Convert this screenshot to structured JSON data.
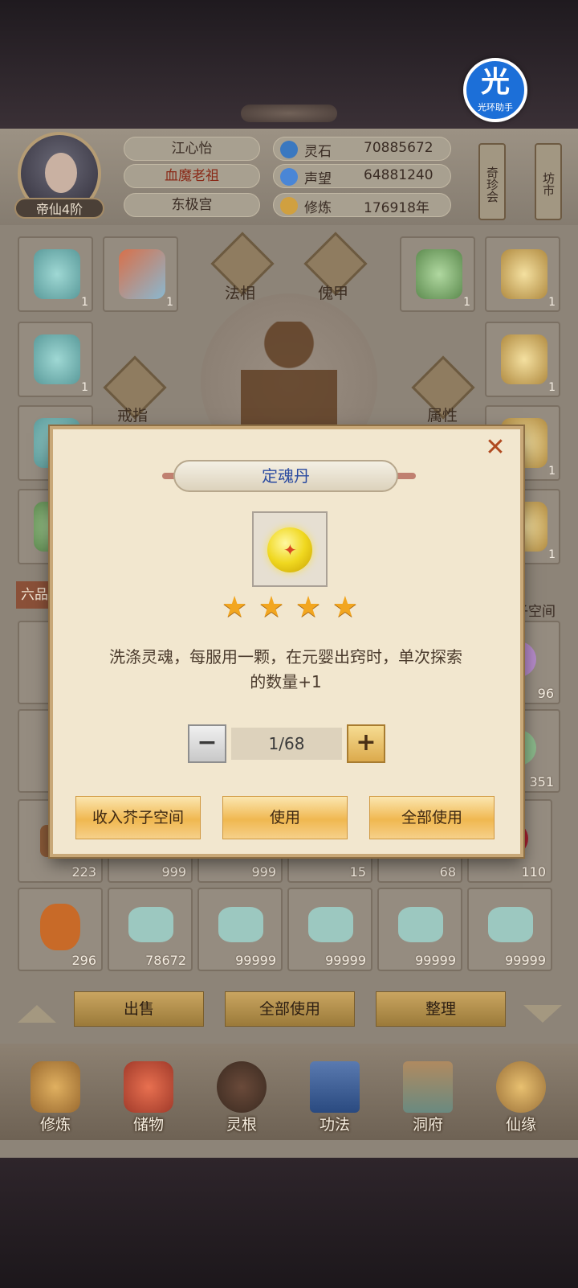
{
  "assistant": {
    "glyph": "光",
    "label": "光环助手"
  },
  "player": {
    "name": "江心怡",
    "master": "血魔老祖",
    "sect": "东极宫",
    "realm": "帝仙4阶"
  },
  "stats": [
    {
      "label": "灵石",
      "value": "70885672",
      "icon": "spirit-stone-icon",
      "color": "#3a78c0"
    },
    {
      "label": "声望",
      "value": "64881240",
      "icon": "reputation-icon",
      "color": "#4a86d6"
    },
    {
      "label": "修炼",
      "value": "176918年",
      "icon": "meditation-icon",
      "color": "#d0a040"
    }
  ],
  "side_signs": {
    "treasure": "奇珍会",
    "market": "坊市"
  },
  "equipment_labels": {
    "faxiang": "法相",
    "kuijia": "傀甲",
    "ring": "戒指",
    "attribute": "属性"
  },
  "equipment_counts": [
    "1",
    "1",
    "1",
    "1",
    "1",
    "1",
    "1",
    "1",
    "1"
  ],
  "inventory": {
    "tab_label": "六品",
    "space_label": "芥子空间",
    "row_counts_partial": [
      "96",
      "351"
    ],
    "row3": [
      "223",
      "999",
      "999",
      "15",
      "68",
      "110"
    ],
    "row4": [
      "296",
      "78672",
      "99999",
      "99999",
      "99999",
      "99999"
    ],
    "actions": {
      "sell": "出售",
      "use_all": "全部使用",
      "sort": "整理"
    }
  },
  "nav": [
    {
      "label": "修炼",
      "icon": "cultivation-icon"
    },
    {
      "label": "储物",
      "icon": "storage-bag-icon"
    },
    {
      "label": "灵根",
      "icon": "spirit-root-icon"
    },
    {
      "label": "功法",
      "icon": "technique-book-icon"
    },
    {
      "label": "洞府",
      "icon": "cave-dwelling-icon"
    },
    {
      "label": "仙缘",
      "icon": "fortune-icon"
    }
  ],
  "modal": {
    "title": "定魂丹",
    "stars": 4,
    "star_glyph": "★",
    "description_line1": "洗涤灵魂，每服用一颗，在元婴出窍时，单次探索",
    "description_line2": "的数量+1",
    "quantity": "1/68",
    "minus": "−",
    "plus": "+",
    "close": "✕",
    "buttons": {
      "store": "收入芥子空间",
      "use": "使用",
      "use_all": "全部使用"
    }
  }
}
